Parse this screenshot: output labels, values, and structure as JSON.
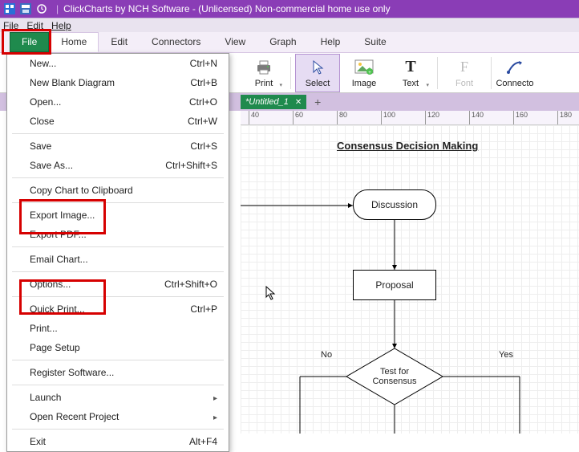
{
  "titlebar": {
    "title": "ClickCharts by NCH Software - (Unlicensed) Non-commercial home use only"
  },
  "menubar": {
    "file": "File",
    "edit": "Edit",
    "help": "Help"
  },
  "tabs": {
    "file": "File",
    "home": "Home",
    "edit": "Edit",
    "connectors": "Connectors",
    "view": "View",
    "graph": "Graph",
    "help": "Help",
    "suite": "Suite"
  },
  "ribbon": {
    "print": "Print",
    "select": "Select",
    "image": "Image",
    "text": "Text",
    "font": "Font",
    "connector": "Connecto"
  },
  "doctab": {
    "name": "*Untitled_1"
  },
  "ruler": {
    "ticks": [
      "40",
      "60",
      "80",
      "100",
      "120",
      "140",
      "160",
      "180"
    ]
  },
  "canvas": {
    "title": "Consensus Decision Making",
    "discussion": "Discussion",
    "proposal": "Proposal",
    "test": "Test for\nConsensus",
    "no": "No",
    "yes": "Yes"
  },
  "menu": {
    "new": "New...",
    "new_sc": "Ctrl+N",
    "blank": "New Blank Diagram",
    "blank_sc": "Ctrl+B",
    "open": "Open...",
    "open_sc": "Ctrl+O",
    "close": "Close",
    "close_sc": "Ctrl+W",
    "save": "Save",
    "save_sc": "Ctrl+S",
    "saveas": "Save As...",
    "saveas_sc": "Ctrl+Shift+S",
    "copy": "Copy Chart to Clipboard",
    "expimg": "Export Image...",
    "exppdf": "Export PDF...",
    "email": "Email Chart...",
    "options": "Options...",
    "options_sc": "Ctrl+Shift+O",
    "qprint": "Quick Print...",
    "qprint_sc": "Ctrl+P",
    "print": "Print...",
    "pagesetup": "Page Setup",
    "register": "Register Software...",
    "launch": "Launch",
    "recent": "Open Recent Project",
    "exit": "Exit",
    "exit_sc": "Alt+F4"
  }
}
